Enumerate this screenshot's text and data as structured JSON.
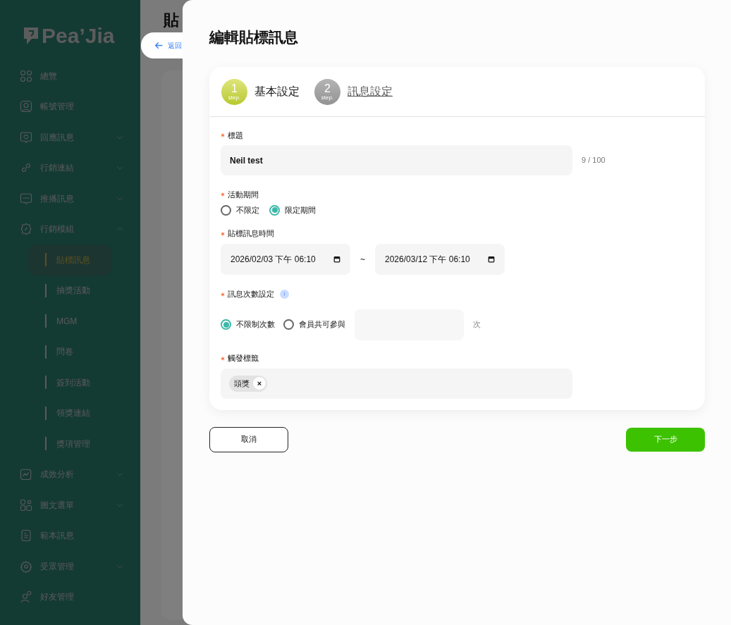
{
  "sidebar": {
    "logo": "Pea’Jia",
    "items": [
      {
        "label": "總覽",
        "kind": "link"
      },
      {
        "label": "帳號管理",
        "kind": "link"
      },
      {
        "label": "回應訊息",
        "kind": "group",
        "expanded": false
      },
      {
        "label": "行銷連結",
        "kind": "group",
        "expanded": false
      },
      {
        "label": "推播訊息",
        "kind": "group",
        "expanded": false
      },
      {
        "label": "行銷模組",
        "kind": "group",
        "expanded": true,
        "children": [
          {
            "label": "貼標訊息",
            "selected": true
          },
          {
            "label": "抽獎活動",
            "selected": false
          },
          {
            "label": "MGM",
            "selected": false
          },
          {
            "label": "問卷",
            "selected": false
          },
          {
            "label": "簽到活動",
            "selected": false
          },
          {
            "label": "領獎連結",
            "selected": false
          },
          {
            "label": "獎項管理",
            "selected": false
          }
        ]
      },
      {
        "label": "成效分析",
        "kind": "group",
        "expanded": false
      },
      {
        "label": "圖文選單",
        "kind": "group",
        "expanded": false
      },
      {
        "label": "範本訊息",
        "kind": "link"
      },
      {
        "label": "受眾管理",
        "kind": "group",
        "expanded": false
      },
      {
        "label": "好友管理",
        "kind": "link"
      }
    ]
  },
  "page": {
    "title": "貼",
    "back_button": "返回"
  },
  "drawer": {
    "title": "編輯貼標訊息",
    "steps": [
      {
        "number": "1",
        "sub": "step.",
        "label": "基本設定",
        "selected": true
      },
      {
        "number": "2",
        "sub": "step.",
        "label": "訊息設定",
        "selected": false
      }
    ],
    "title_field": {
      "label": "標題",
      "required": true,
      "value": "Neil test",
      "counter": "9 / 100"
    },
    "period": {
      "label": "活動期間",
      "required": true,
      "options": [
        {
          "label": "不限定",
          "selected": false
        },
        {
          "label": "限定期間",
          "selected": true
        }
      ]
    },
    "time": {
      "label": "貼標訊息時間",
      "required": true,
      "start": "2026/02/03 下午 06:10",
      "separator": "~",
      "end": "2026/03/12 下午 06:10"
    },
    "count": {
      "label": "訊息次數設定",
      "required": true,
      "info": "!",
      "options": [
        {
          "label": "不限制次數",
          "selected": true
        },
        {
          "label": "會員共可參與",
          "selected": false
        }
      ],
      "unit": "次"
    },
    "tags": {
      "label": "觸發標籤",
      "required": true,
      "items": [
        {
          "label": "頭獎",
          "remove": "×"
        }
      ]
    },
    "buttons": {
      "cancel": "取消",
      "next": "下一步"
    }
  }
}
